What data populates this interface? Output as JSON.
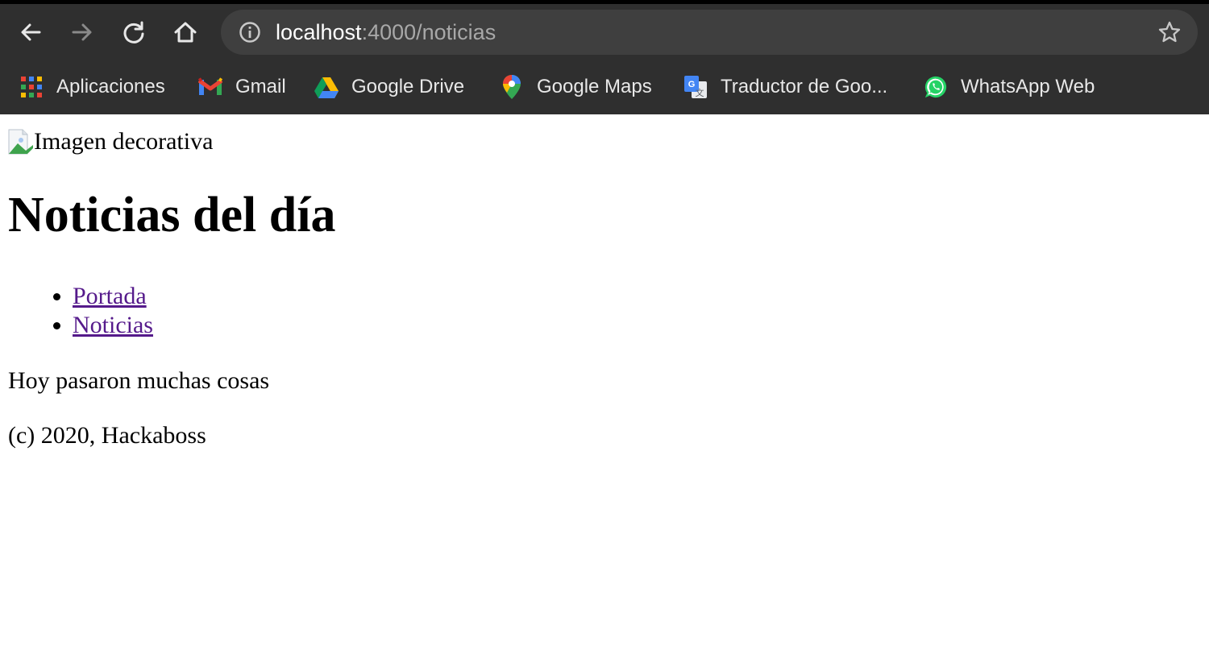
{
  "browser": {
    "url_host": "localhost",
    "url_path": ":4000/noticias",
    "bookmarks": [
      {
        "label": "Aplicaciones",
        "icon": "apps-grid-icon"
      },
      {
        "label": "Gmail",
        "icon": "gmail-icon"
      },
      {
        "label": "Google Drive",
        "icon": "google-drive-icon"
      },
      {
        "label": "Google Maps",
        "icon": "google-maps-icon"
      },
      {
        "label": "Traductor de Goo...",
        "icon": "google-translate-icon"
      },
      {
        "label": "WhatsApp Web",
        "icon": "whatsapp-icon"
      }
    ]
  },
  "page": {
    "image_alt": "Imagen decorativa",
    "title": "Noticias del día",
    "nav": [
      {
        "label": "Portada"
      },
      {
        "label": "Noticias"
      }
    ],
    "body_text": "Hoy pasaron muchas cosas",
    "footer": "(c) 2020, Hackaboss"
  },
  "colors": {
    "chrome_bg": "#2f2f2f",
    "omnibox_bg": "#3f3f3f",
    "link_visited": "#551a8b",
    "page_bg": "#ffffff"
  }
}
